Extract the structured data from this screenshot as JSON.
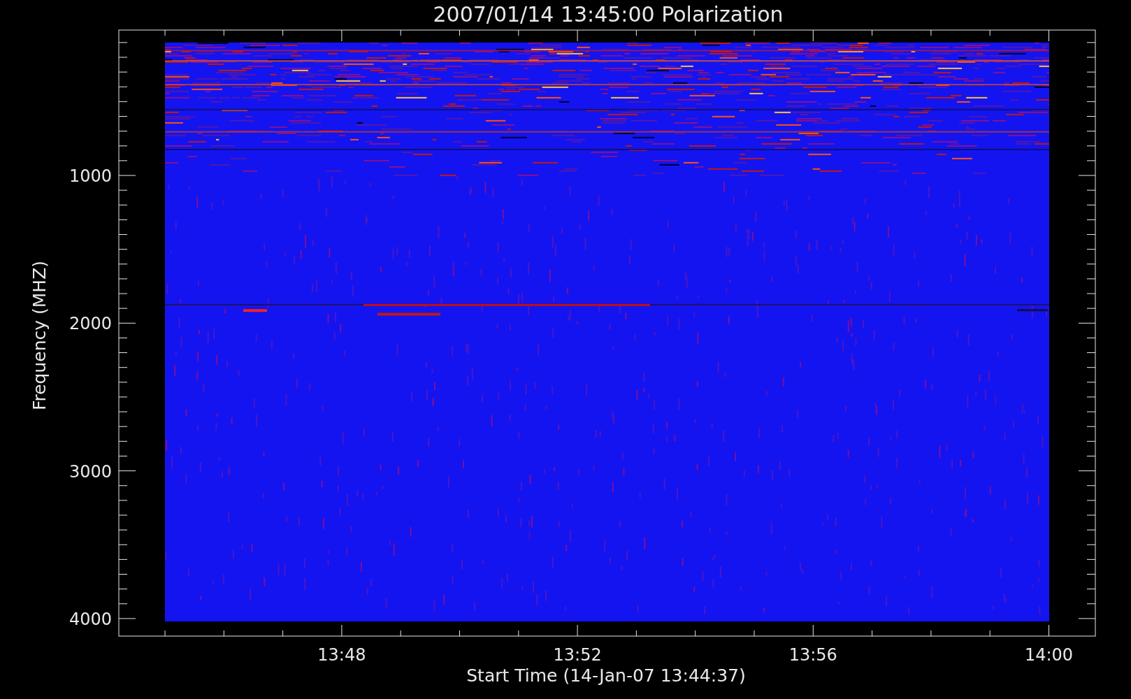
{
  "plot": {
    "title": "2007/01/14 13:45:00 Polarization",
    "xlabel": "Start Time (14-Jan-07 13:44:37)",
    "ylabel": "Frequency (MHZ)",
    "xticks": [
      "13:48",
      "13:52",
      "13:56",
      "14:00"
    ],
    "yticks": [
      "1000",
      "2000",
      "3000",
      "4000"
    ]
  }
}
